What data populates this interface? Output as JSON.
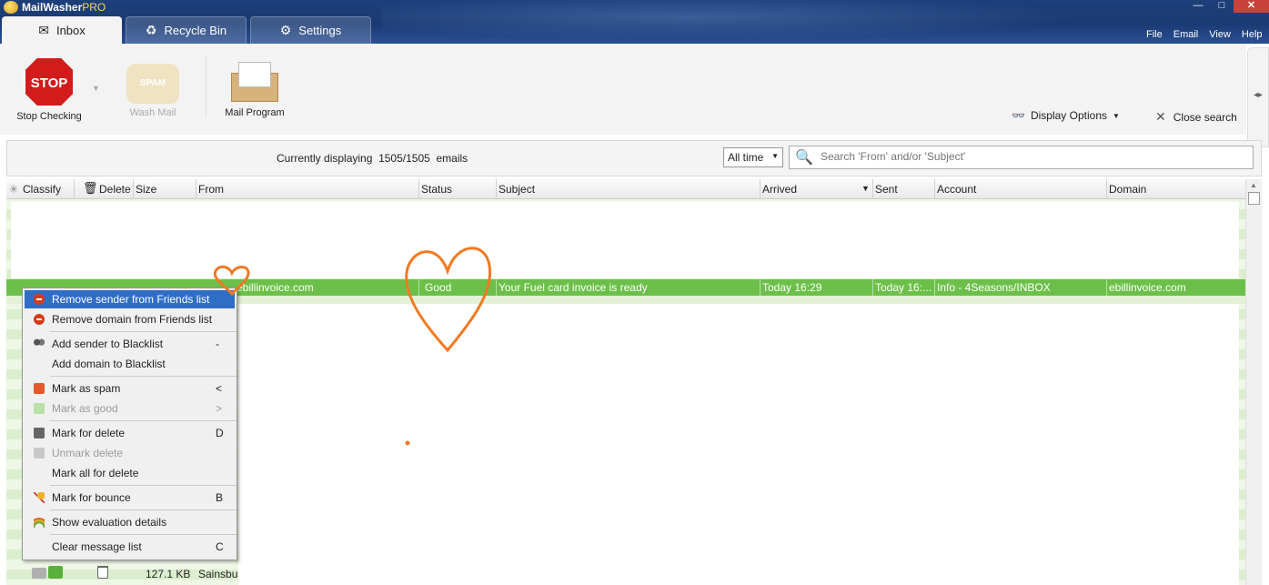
{
  "app": {
    "title_main": "MailWasher",
    "title_pro": "PRO",
    "window_buttons": {
      "minimize": "—",
      "maximize": "□",
      "close": "✕"
    }
  },
  "tabs": [
    {
      "label": "Inbox",
      "icon": "inbox-icon",
      "active": true
    },
    {
      "label": "Recycle Bin",
      "icon": "recycle-icon",
      "active": false
    },
    {
      "label": "Settings",
      "icon": "gear-icon",
      "active": false
    }
  ],
  "menu": [
    "File",
    "Email",
    "View",
    "Help"
  ],
  "ribbon": {
    "stop_checking": "Stop Checking",
    "stop_sign_text": "STOP",
    "wash_mail": "Wash Mail",
    "wash_icon_text": "SPAM",
    "mail_program": "Mail Program",
    "display_options": "Display Options",
    "close_search": "Close search"
  },
  "searchbar": {
    "displaying_prefix": "Currently displaying",
    "displaying_count": "1505/1505",
    "displaying_suffix": "emails",
    "time_filter": "All time",
    "search_placeholder": "Search 'From' and/or 'Subject'"
  },
  "columns": [
    "Classify",
    "Delete",
    "Size",
    "From",
    "Status",
    "Subject",
    "Arrived",
    "Sent",
    "Account",
    "Domain"
  ],
  "selected_row": {
    "from": "ebillinvoice.com",
    "status": "Good",
    "subject": "Your Fuel card invoice is ready",
    "arrived": "Today 16:29",
    "sent": "Today 16:...",
    "account": "Info - 4Seasons/INBOX",
    "domain": "ebillinvoice.com"
  },
  "bottom_row": {
    "size": "127.1 KB",
    "from": "Sainsbu"
  },
  "context_menu": [
    {
      "label": "Remove sender from Friends list",
      "key": "",
      "icon": "remove-circle-icon",
      "state": "highlight"
    },
    {
      "label": "Remove domain from Friends list",
      "key": "",
      "icon": "remove-circle-icon",
      "state": "normal"
    },
    {
      "label": "Add sender to Blacklist",
      "key": "-",
      "icon": "blacklist-people-icon",
      "state": "normal"
    },
    {
      "label": "Add domain to Blacklist",
      "key": "",
      "icon": "",
      "state": "normal"
    },
    {
      "label": "Mark as spam",
      "key": "<",
      "icon": "thumbs-down-icon",
      "state": "normal"
    },
    {
      "label": "Mark as good",
      "key": ">",
      "icon": "thumbs-up-icon",
      "state": "disabled"
    },
    {
      "label": "Mark for delete",
      "key": "D",
      "icon": "trash-icon",
      "state": "normal"
    },
    {
      "label": "Unmark delete",
      "key": "",
      "icon": "trash-disabled-icon",
      "state": "disabled"
    },
    {
      "label": "Mark all for delete",
      "key": "",
      "icon": "",
      "state": "normal"
    },
    {
      "label": "Mark for bounce",
      "key": "B",
      "icon": "bounce-icon",
      "state": "normal"
    },
    {
      "label": "Show evaluation details",
      "key": "",
      "icon": "gauge-icon",
      "state": "normal"
    },
    {
      "label": "Clear message list",
      "key": "C",
      "icon": "",
      "state": "normal"
    }
  ],
  "colors": {
    "accent": "#2f6ec7",
    "selected_row": "#6cc04a",
    "annotation": "#f07a22"
  }
}
